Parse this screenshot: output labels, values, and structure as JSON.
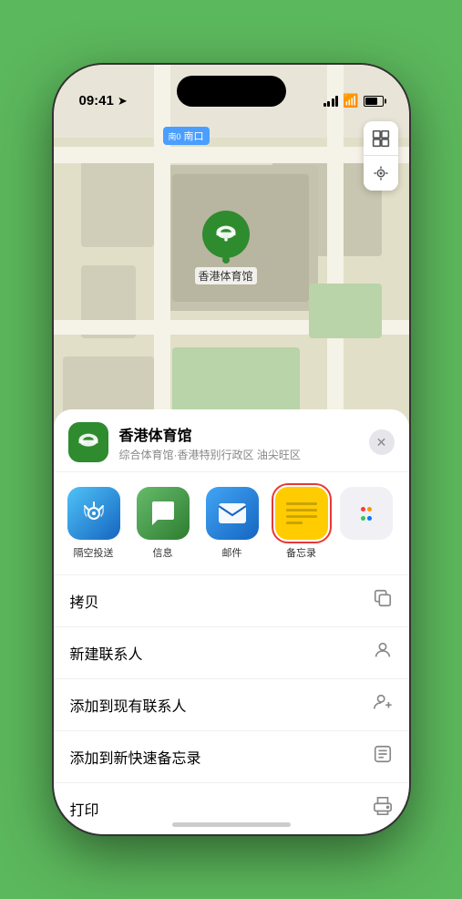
{
  "status_bar": {
    "time": "09:41",
    "location_arrow": "▶"
  },
  "map": {
    "label_text": "南口",
    "label_prefix": "南0",
    "venue_pin_label": "香港体育馆"
  },
  "venue": {
    "name": "香港体育馆",
    "description": "综合体育馆·香港特别行政区 油尖旺区",
    "icon": "🏟️"
  },
  "share_apps": [
    {
      "id": "airdrop",
      "label": "隔空投送",
      "type": "airdrop"
    },
    {
      "id": "message",
      "label": "信息",
      "type": "message"
    },
    {
      "id": "mail",
      "label": "邮件",
      "type": "mail"
    },
    {
      "id": "notes",
      "label": "备忘录",
      "type": "notes",
      "selected": true
    }
  ],
  "actions": [
    {
      "label": "拷贝",
      "icon": "copy"
    },
    {
      "label": "新建联系人",
      "icon": "person"
    },
    {
      "label": "添加到现有联系人",
      "icon": "person-add"
    },
    {
      "label": "添加到新快速备忘录",
      "icon": "memo"
    },
    {
      "label": "打印",
      "icon": "printer"
    }
  ],
  "close_button_label": "✕"
}
